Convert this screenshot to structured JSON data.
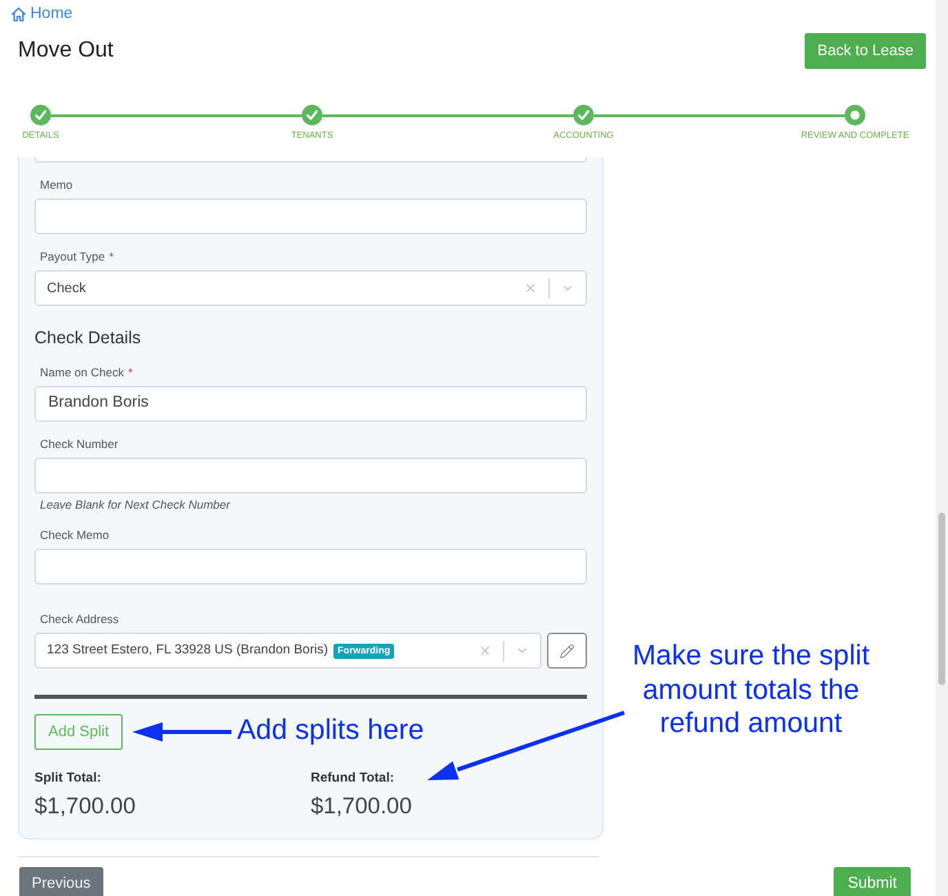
{
  "breadcrumb": {
    "label": "Home"
  },
  "header": {
    "title": "Move Out",
    "back_button": "Back to Lease"
  },
  "stepper": [
    {
      "label": "DETAILS",
      "completed": true
    },
    {
      "label": "TENANTS",
      "completed": true
    },
    {
      "label": "ACCOUNTING",
      "completed": true
    },
    {
      "label": "REVIEW AND COMPLETE",
      "completed": false
    }
  ],
  "form": {
    "fields": [
      {
        "kind": "input",
        "label": "Memo"
      },
      {
        "kind": "select",
        "label": "Payout Type",
        "required_mark": "*",
        "value": "Check"
      },
      {
        "kind": "heading",
        "text": "Check Details"
      },
      {
        "kind": "input",
        "label": "Name on Check",
        "required_mark": "*",
        "value": "Brandon Boris"
      },
      {
        "kind": "input",
        "label": "Check Number",
        "hint": "Leave Blank for Next Check Number"
      },
      {
        "kind": "input",
        "label": "Check Memo"
      },
      {
        "kind": "address",
        "label": "Check Address",
        "value": "123 Street Estero, FL 33928 US (Brandon Boris)",
        "badge": "Forwarding"
      }
    ],
    "add_split_button": "Add Split",
    "totals": [
      {
        "label": "Split Total:",
        "value": "$1,700.00"
      },
      {
        "label": "Refund Total:",
        "value": "$1,700.00"
      }
    ]
  },
  "footer": {
    "previous_button": "Previous",
    "submit_button": "Submit"
  },
  "annotations": [
    {
      "text": "Add splits here"
    },
    {
      "text": "Make sure the split amount totals the refund amount"
    }
  ]
}
